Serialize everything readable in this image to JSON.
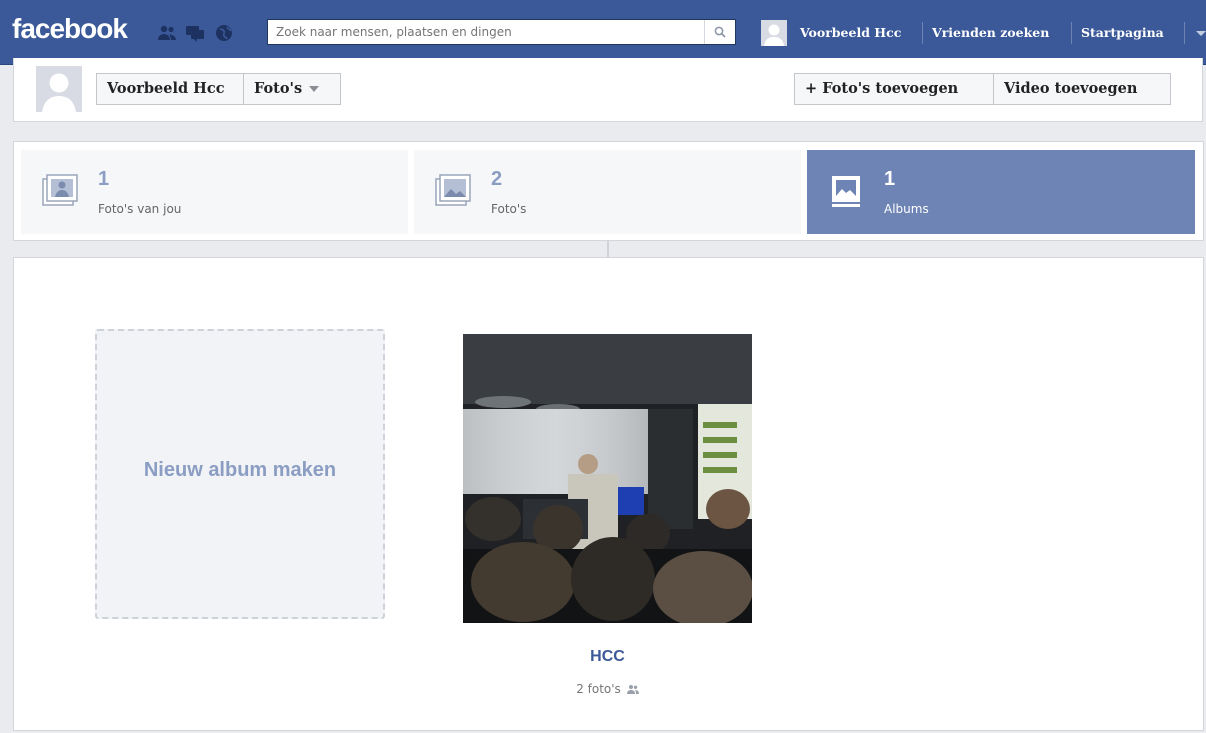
{
  "topbar": {
    "logo": "facebook",
    "search_placeholder": "Zoek naar mensen, plaatsen en dingen",
    "user_name": "Voorbeeld Hcc",
    "find_friends": "Vrienden zoeken",
    "home": "Startpagina",
    "brand_color": "#3b5998"
  },
  "subheader": {
    "profile_name_button": "Voorbeeld Hcc",
    "photos_dropdown": "Foto's",
    "add_photos_button": "+ Foto's toevoegen",
    "add_video_button": "Video toevoegen"
  },
  "tabs": [
    {
      "count": "1",
      "label": "Foto's van jou",
      "icon": "tagged-photos-icon",
      "active": false
    },
    {
      "count": "2",
      "label": "Foto's",
      "icon": "photos-icon",
      "active": false
    },
    {
      "count": "1",
      "label": "Albums",
      "icon": "albums-icon",
      "active": true
    }
  ],
  "albums": {
    "new_album_label": "Nieuw album maken",
    "items": [
      {
        "title": "HCC",
        "meta": "2 foto's",
        "privacy_icon": "friends-icon"
      }
    ]
  }
}
